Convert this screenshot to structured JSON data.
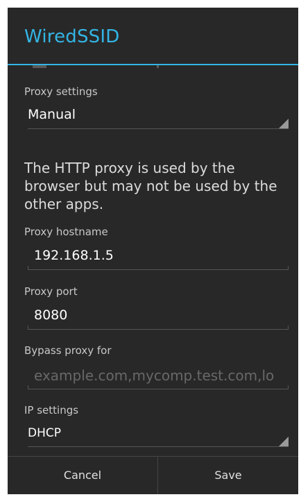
{
  "dialog": {
    "title": "WiredSSID",
    "accent_color": "#33b5e5",
    "background_color": "#282828"
  },
  "proxy_settings": {
    "label": "Proxy settings",
    "selected": "Manual"
  },
  "info_text": "The HTTP proxy is used by the browser but may not be used by the other apps.",
  "proxy_hostname": {
    "label": "Proxy hostname",
    "value": "192.168.1.5"
  },
  "proxy_port": {
    "label": "Proxy port",
    "value": "8080"
  },
  "bypass_proxy": {
    "label": "Bypass proxy for",
    "placeholder": "example.com,mycomp.test.com,lo"
  },
  "ip_settings": {
    "label": "IP settings",
    "selected": "DHCP"
  },
  "buttons": {
    "cancel": "Cancel",
    "save": "Save"
  }
}
